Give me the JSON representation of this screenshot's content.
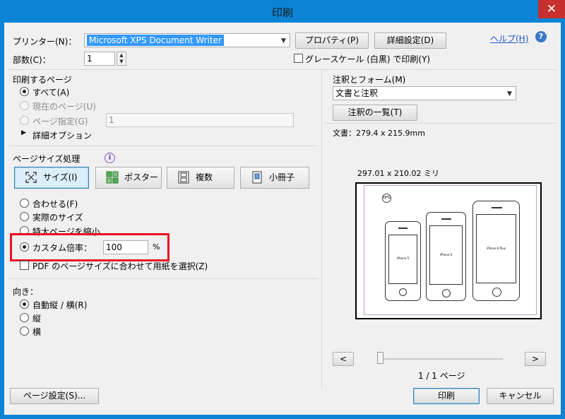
{
  "window": {
    "title": "印刷",
    "close": "✕"
  },
  "printer": {
    "label": "プリンター(N)：",
    "selected": "Microsoft XPS Document Writer",
    "properties_button": "プロパティ(P)",
    "advanced_button": "詳細設定(D)",
    "help_link": "ヘルプ(H)",
    "help_icon": "?"
  },
  "copies": {
    "label": "部数(C)：",
    "value": "1"
  },
  "grayscale": {
    "label": "グレースケール (白黒) で印刷(Y)",
    "checked": false
  },
  "pages": {
    "heading": "印刷するページ",
    "options": [
      {
        "label": "すべて(A)",
        "selected": true,
        "enabled": true
      },
      {
        "label": "現在のページ(U)",
        "selected": false,
        "enabled": false
      },
      {
        "label": "ページ指定(G)",
        "selected": false,
        "enabled": false
      }
    ],
    "range_value": "1",
    "more_options": "詳細オプション",
    "more_options_icon": "triangle-right-icon"
  },
  "sizing": {
    "heading": "ページサイズ処理",
    "info_icon": "i",
    "modes": [
      {
        "label": "サイズ(I)",
        "icon": "resize-icon",
        "active": true
      },
      {
        "label": "ポスター",
        "icon": "poster-icon",
        "active": false
      },
      {
        "label": "複数",
        "icon": "multiple-icon",
        "active": false
      },
      {
        "label": "小冊子",
        "icon": "booklet-icon",
        "active": false
      }
    ],
    "options": [
      {
        "label": "合わせる(F)",
        "selected": false
      },
      {
        "label": "実際のサイズ",
        "selected": false
      },
      {
        "label": "特大ページを縮小",
        "selected": false
      },
      {
        "label": "カスタム倍率：",
        "selected": true
      }
    ],
    "custom_scale_value": "100",
    "percent": "%",
    "paper_by_pdf_label": "PDF のページサイズに合わせて用紙を選択(Z)",
    "highlight_color": "#e81123"
  },
  "orientation": {
    "heading": "向き：",
    "options": [
      {
        "label": "自動縦 / 横(R)",
        "selected": true
      },
      {
        "label": "縦",
        "selected": false
      },
      {
        "label": "横",
        "selected": false
      }
    ]
  },
  "comments": {
    "heading": "注釈とフォーム(M)",
    "selected": "文書と注釈",
    "summary_button": "注釈の一覧(T)"
  },
  "preview": {
    "document_size": "文書：279.4 x 215.9mm",
    "sheet_size": "297.01 x 210.02 ミリ",
    "page_info": "1 / 1 ページ",
    "prev": "<",
    "next": ">",
    "page_badge": "DFG",
    "phones": [
      "iPhone 5",
      "iPhone 6",
      "iPhone 6 Plus"
    ]
  },
  "footer": {
    "page_setup": "ページ設定(S)...",
    "print": "印刷",
    "cancel": "キャンセル"
  },
  "colors": {
    "titlebar": "#0b84d6",
    "client": "#f0f0f0",
    "accent": "#3399ff",
    "close": "#c7302f"
  }
}
